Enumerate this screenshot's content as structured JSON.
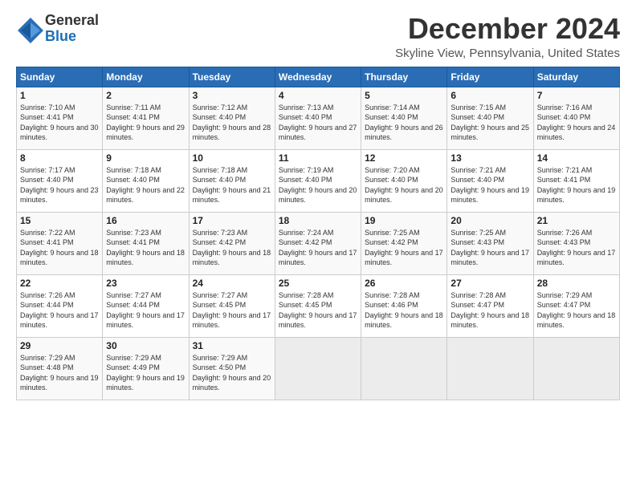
{
  "logo": {
    "general": "General",
    "blue": "Blue"
  },
  "title": "December 2024",
  "location": "Skyline View, Pennsylvania, United States",
  "days_of_week": [
    "Sunday",
    "Monday",
    "Tuesday",
    "Wednesday",
    "Thursday",
    "Friday",
    "Saturday"
  ],
  "weeks": [
    [
      {
        "day": "1",
        "info": "Sunrise: 7:10 AM\nSunset: 4:41 PM\nDaylight: 9 hours and 30 minutes."
      },
      {
        "day": "2",
        "info": "Sunrise: 7:11 AM\nSunset: 4:41 PM\nDaylight: 9 hours and 29 minutes."
      },
      {
        "day": "3",
        "info": "Sunrise: 7:12 AM\nSunset: 4:40 PM\nDaylight: 9 hours and 28 minutes."
      },
      {
        "day": "4",
        "info": "Sunrise: 7:13 AM\nSunset: 4:40 PM\nDaylight: 9 hours and 27 minutes."
      },
      {
        "day": "5",
        "info": "Sunrise: 7:14 AM\nSunset: 4:40 PM\nDaylight: 9 hours and 26 minutes."
      },
      {
        "day": "6",
        "info": "Sunrise: 7:15 AM\nSunset: 4:40 PM\nDaylight: 9 hours and 25 minutes."
      },
      {
        "day": "7",
        "info": "Sunrise: 7:16 AM\nSunset: 4:40 PM\nDaylight: 9 hours and 24 minutes."
      }
    ],
    [
      {
        "day": "8",
        "info": "Sunrise: 7:17 AM\nSunset: 4:40 PM\nDaylight: 9 hours and 23 minutes."
      },
      {
        "day": "9",
        "info": "Sunrise: 7:18 AM\nSunset: 4:40 PM\nDaylight: 9 hours and 22 minutes."
      },
      {
        "day": "10",
        "info": "Sunrise: 7:18 AM\nSunset: 4:40 PM\nDaylight: 9 hours and 21 minutes."
      },
      {
        "day": "11",
        "info": "Sunrise: 7:19 AM\nSunset: 4:40 PM\nDaylight: 9 hours and 20 minutes."
      },
      {
        "day": "12",
        "info": "Sunrise: 7:20 AM\nSunset: 4:40 PM\nDaylight: 9 hours and 20 minutes."
      },
      {
        "day": "13",
        "info": "Sunrise: 7:21 AM\nSunset: 4:40 PM\nDaylight: 9 hours and 19 minutes."
      },
      {
        "day": "14",
        "info": "Sunrise: 7:21 AM\nSunset: 4:41 PM\nDaylight: 9 hours and 19 minutes."
      }
    ],
    [
      {
        "day": "15",
        "info": "Sunrise: 7:22 AM\nSunset: 4:41 PM\nDaylight: 9 hours and 18 minutes."
      },
      {
        "day": "16",
        "info": "Sunrise: 7:23 AM\nSunset: 4:41 PM\nDaylight: 9 hours and 18 minutes."
      },
      {
        "day": "17",
        "info": "Sunrise: 7:23 AM\nSunset: 4:42 PM\nDaylight: 9 hours and 18 minutes."
      },
      {
        "day": "18",
        "info": "Sunrise: 7:24 AM\nSunset: 4:42 PM\nDaylight: 9 hours and 17 minutes."
      },
      {
        "day": "19",
        "info": "Sunrise: 7:25 AM\nSunset: 4:42 PM\nDaylight: 9 hours and 17 minutes."
      },
      {
        "day": "20",
        "info": "Sunrise: 7:25 AM\nSunset: 4:43 PM\nDaylight: 9 hours and 17 minutes."
      },
      {
        "day": "21",
        "info": "Sunrise: 7:26 AM\nSunset: 4:43 PM\nDaylight: 9 hours and 17 minutes."
      }
    ],
    [
      {
        "day": "22",
        "info": "Sunrise: 7:26 AM\nSunset: 4:44 PM\nDaylight: 9 hours and 17 minutes."
      },
      {
        "day": "23",
        "info": "Sunrise: 7:27 AM\nSunset: 4:44 PM\nDaylight: 9 hours and 17 minutes."
      },
      {
        "day": "24",
        "info": "Sunrise: 7:27 AM\nSunset: 4:45 PM\nDaylight: 9 hours and 17 minutes."
      },
      {
        "day": "25",
        "info": "Sunrise: 7:28 AM\nSunset: 4:45 PM\nDaylight: 9 hours and 17 minutes."
      },
      {
        "day": "26",
        "info": "Sunrise: 7:28 AM\nSunset: 4:46 PM\nDaylight: 9 hours and 18 minutes."
      },
      {
        "day": "27",
        "info": "Sunrise: 7:28 AM\nSunset: 4:47 PM\nDaylight: 9 hours and 18 minutes."
      },
      {
        "day": "28",
        "info": "Sunrise: 7:29 AM\nSunset: 4:47 PM\nDaylight: 9 hours and 18 minutes."
      }
    ],
    [
      {
        "day": "29",
        "info": "Sunrise: 7:29 AM\nSunset: 4:48 PM\nDaylight: 9 hours and 19 minutes."
      },
      {
        "day": "30",
        "info": "Sunrise: 7:29 AM\nSunset: 4:49 PM\nDaylight: 9 hours and 19 minutes."
      },
      {
        "day": "31",
        "info": "Sunrise: 7:29 AM\nSunset: 4:50 PM\nDaylight: 9 hours and 20 minutes."
      },
      {
        "day": "",
        "info": ""
      },
      {
        "day": "",
        "info": ""
      },
      {
        "day": "",
        "info": ""
      },
      {
        "day": "",
        "info": ""
      }
    ]
  ]
}
